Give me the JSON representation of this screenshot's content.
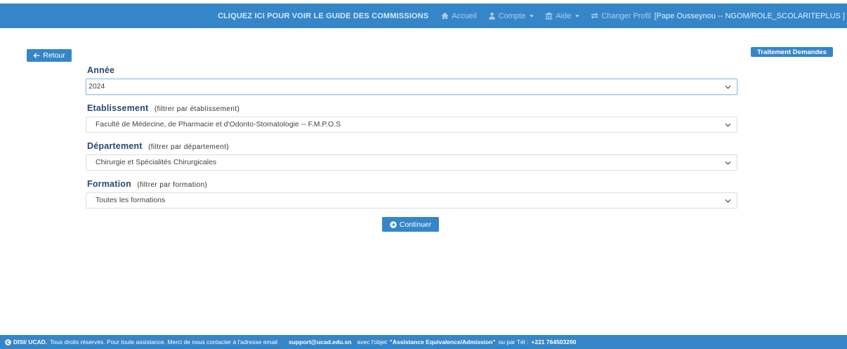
{
  "colors": {
    "primary": "#3586c9",
    "heading": "#264a74",
    "focus_border": "#9ac2e6"
  },
  "navbar": {
    "guide_link": "CLIQUEZ ICI POUR VOIR LE GUIDE DES COMMISSIONS",
    "items": [
      {
        "label": "Accueil",
        "icon": "home-icon"
      },
      {
        "label": "Compte",
        "icon": "user-icon",
        "has_dropdown": true
      },
      {
        "label": "Aide",
        "icon": "institution-icon",
        "has_dropdown": true
      },
      {
        "label": "Changer Profil",
        "icon": "exchange-icon"
      }
    ],
    "user_info": "[Pape Ousseynou -- NGOM/ROLE_SCOLARITEPLUS ]"
  },
  "actions": {
    "back_label": "Retour",
    "back_icon": "arrow-left-icon",
    "treatment_label": "Traitement Demandes"
  },
  "form": {
    "fields": [
      {
        "label": "Année",
        "value": "2024"
      },
      {
        "label": "Etablissement",
        "hint": "(filtrer par établissement)",
        "value": "Faculté de Médecine, de Pharmacie et d'Odonto-Stomatologie -- F.M.P.O.S"
      },
      {
        "label": "Département",
        "hint": "(filtrer par département)",
        "value": "Chirurgie et Spécialités Chirurgicales"
      },
      {
        "label": "Formation",
        "hint": "(filtrer par formation)",
        "value": "Toutes les formations"
      }
    ],
    "submit_label": "Continuer",
    "submit_icon": "circle-arrow-right-icon"
  },
  "footer": {
    "icon": "copyright-icon",
    "org": "DISI/ UCAD.",
    "text": "Tous droits réservés. Pour toute assistance. Merci de nous contacter à l'adresse email",
    "email": "support@ucad.edu.sn",
    "subject_prefix": "avec l'objet",
    "subject": "\"Assistance Equivalence/Admission\"",
    "phone_prefix": "ou par Tél :",
    "phone": "+221 764503290"
  }
}
